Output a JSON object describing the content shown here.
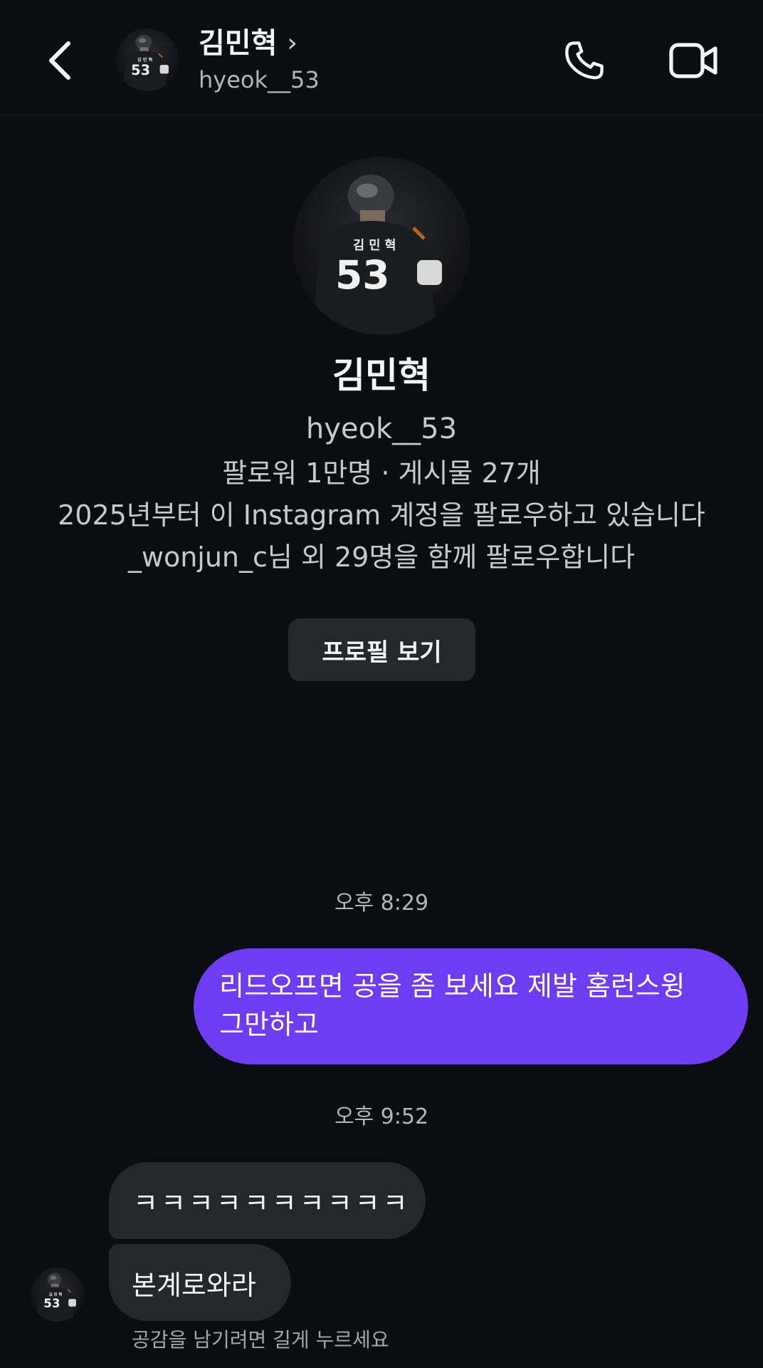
{
  "header": {
    "back_icon": "chevron-left-icon",
    "name": "김민혁",
    "name_chevron": "›",
    "handle": "hyeok__53",
    "call_icon": "phone-icon",
    "video_icon": "video-camera-icon"
  },
  "profile": {
    "name": "김민혁",
    "handle": "hyeok__53",
    "stats": "팔로워 1만명 · 게시물 27개",
    "following_since": "2025년부터 이 Instagram 계정을 팔로우하고 있습니다",
    "mutual_followers": "_wonjun_c님 외 29명을 함께 팔로우합니다",
    "view_profile_label": "프로필 보기"
  },
  "messages": [
    {
      "timestamp": "오후 8:29",
      "direction": "outgoing",
      "lines": [
        "리드오프면 공을 좀 보세요 제발 홈런스윙",
        "그만하고"
      ]
    },
    {
      "timestamp": "오후 9:52",
      "direction": "incoming",
      "texts": [
        "ㅋㅋㅋㅋㅋㅋㅋㅋㅋㅋ",
        "본계로와라"
      ]
    }
  ],
  "reaction_hint": "공감을 남기려면 길게 누르세요",
  "colors": {
    "background": "#0c0d12",
    "outgoing_bubble": "#6e3df3",
    "incoming_bubble": "#26272d",
    "button_bg": "#26272d"
  }
}
